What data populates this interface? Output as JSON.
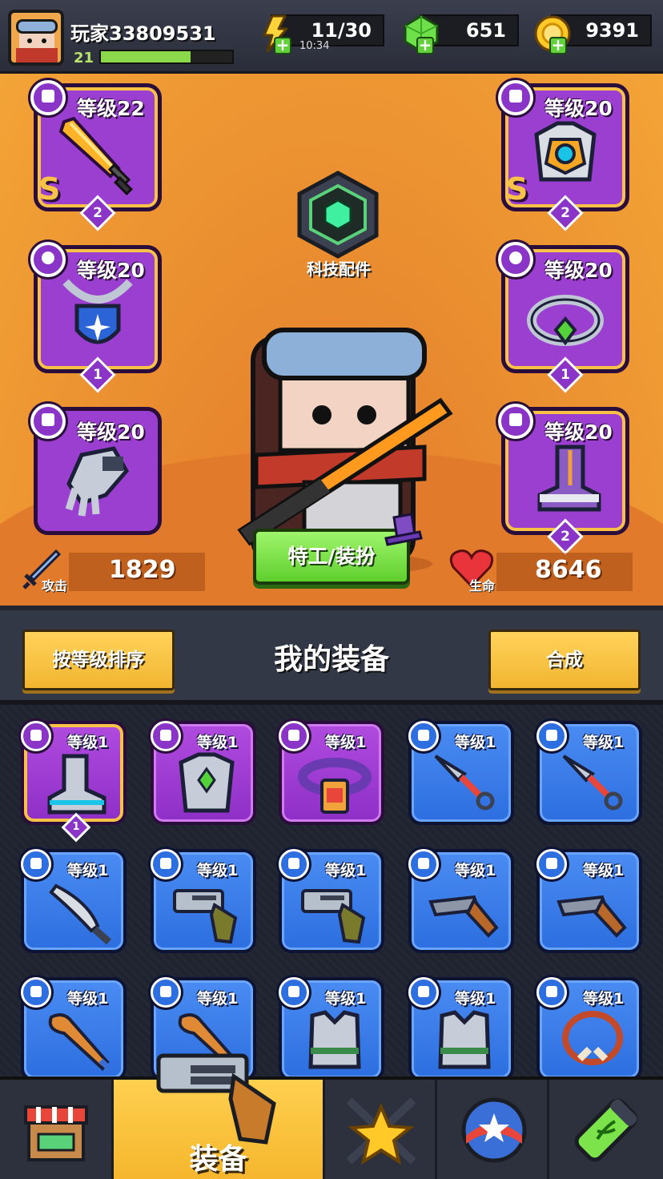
{
  "player": {
    "name": "玩家33809531",
    "level": "21",
    "xp_fraction": 0.68
  },
  "resources": {
    "energy": {
      "value": "11/30",
      "timer": "10:34",
      "icon": "lightning-icon"
    },
    "gems": {
      "value": "651",
      "icon": "green-gem-icon"
    },
    "coins": {
      "value": "9391",
      "icon": "gold-coin-icon"
    }
  },
  "tech_parts": {
    "label": "科技配件",
    "icon": "hex-gem-badge-icon"
  },
  "equipped": {
    "left": [
      {
        "level_text": "等级22",
        "slot": "weapon",
        "art": "sword-icon",
        "rank": "S",
        "stars": "2"
      },
      {
        "level_text": "等级20",
        "slot": "necklace",
        "art": "shield-amulet-icon",
        "rank": "",
        "stars": "1"
      },
      {
        "level_text": "等级20",
        "slot": "gloves",
        "art": "gauntlet-icon",
        "rank": "",
        "stars": ""
      }
    ],
    "right": [
      {
        "level_text": "等级20",
        "slot": "armor",
        "art": "chest-armor-icon",
        "rank": "S",
        "stars": "2"
      },
      {
        "level_text": "等级20",
        "slot": "ring",
        "art": "ring-icon",
        "rank": "",
        "stars": "1"
      },
      {
        "level_text": "等级20",
        "slot": "boots",
        "art": "boot-icon",
        "rank": "",
        "stars": "2"
      }
    ]
  },
  "stats": {
    "attack": {
      "label": "攻击",
      "value": "1829"
    },
    "hp": {
      "label": "生命",
      "value": "8646"
    }
  },
  "agent_button": "特工/装扮",
  "inventory_header": {
    "sort_button": "按等级排序",
    "title": "我的装备",
    "merge_button": "合成"
  },
  "inventory": [
    {
      "level_text": "等级1",
      "rarity": "purple",
      "gold": true,
      "art": "boot-icon",
      "stars": "1"
    },
    {
      "level_text": "等级1",
      "rarity": "purple",
      "gold": false,
      "art": "chest-armor-icon",
      "stars": ""
    },
    {
      "level_text": "等级1",
      "rarity": "purple",
      "gold": false,
      "art": "belt-icon",
      "stars": ""
    },
    {
      "level_text": "等级1",
      "rarity": "blue",
      "gold": false,
      "art": "kunai-icon",
      "stars": ""
    },
    {
      "level_text": "等级1",
      "rarity": "blue",
      "gold": false,
      "art": "kunai-icon",
      "stars": ""
    },
    {
      "level_text": "等级1",
      "rarity": "blue",
      "gold": false,
      "art": "machete-icon",
      "stars": ""
    },
    {
      "level_text": "等级1",
      "rarity": "blue",
      "gold": false,
      "art": "revolver-icon",
      "stars": ""
    },
    {
      "level_text": "等级1",
      "rarity": "blue",
      "gold": false,
      "art": "revolver-icon",
      "stars": ""
    },
    {
      "level_text": "等级1",
      "rarity": "blue",
      "gold": false,
      "art": "shotgun-icon",
      "stars": ""
    },
    {
      "level_text": "等级1",
      "rarity": "blue",
      "gold": false,
      "art": "shotgun-icon",
      "stars": ""
    },
    {
      "level_text": "等级1",
      "rarity": "blue",
      "gold": false,
      "art": "bat-icon",
      "stars": ""
    },
    {
      "level_text": "等级1",
      "rarity": "blue",
      "gold": false,
      "art": "bat-icon",
      "stars": ""
    },
    {
      "level_text": "等级1",
      "rarity": "blue",
      "gold": false,
      "art": "vest-icon",
      "stars": ""
    },
    {
      "level_text": "等级1",
      "rarity": "blue",
      "gold": false,
      "art": "vest-icon",
      "stars": ""
    },
    {
      "level_text": "等级1",
      "rarity": "blue",
      "gold": false,
      "art": "bone-necklace-icon",
      "stars": ""
    }
  ],
  "nav": {
    "tabs": [
      {
        "icon": "shop-icon",
        "label": ""
      },
      {
        "icon": "revolver-icon",
        "label": "装备",
        "active": true
      },
      {
        "icon": "crossed-swords-star-icon",
        "label": ""
      },
      {
        "icon": "star-orb-icon",
        "label": ""
      },
      {
        "icon": "dna-capsule-icon",
        "label": ""
      }
    ]
  },
  "colors": {
    "accent_yellow": "#f7c246",
    "rarity_purple": "#9b3fd1",
    "rarity_blue": "#2d6ee0",
    "button_green": "#5fcf2e",
    "hero_orange": "#e88a2f"
  }
}
